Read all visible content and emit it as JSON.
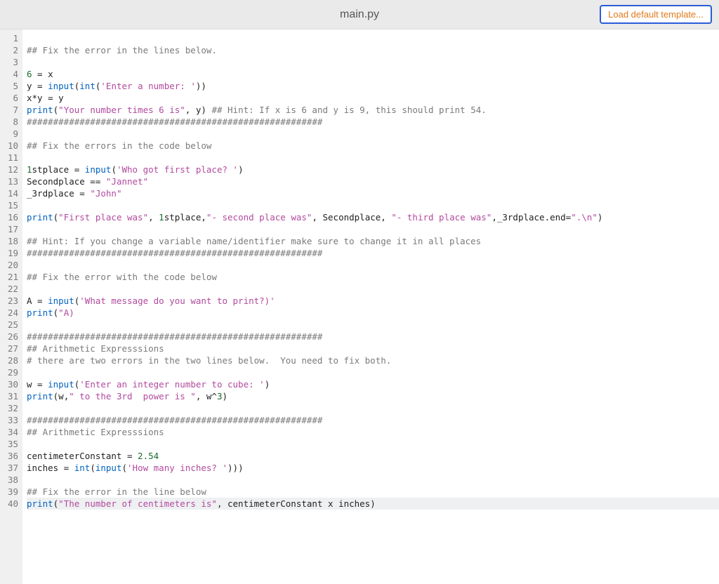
{
  "header": {
    "title": "main.py",
    "load_button": "Load default template..."
  },
  "editor": {
    "highlight_line": 40,
    "lines": [
      [],
      [
        {
          "t": "cm",
          "v": "## Fix the error in the lines below."
        }
      ],
      [],
      [
        {
          "t": "num",
          "v": "6"
        },
        {
          "t": "id",
          "v": " = x"
        }
      ],
      [
        {
          "t": "id",
          "v": "y = "
        },
        {
          "t": "fn",
          "v": "input"
        },
        {
          "t": "id",
          "v": "("
        },
        {
          "t": "fn",
          "v": "int"
        },
        {
          "t": "id",
          "v": "("
        },
        {
          "t": "str",
          "v": "'Enter a number: '"
        },
        {
          "t": "id",
          "v": "))"
        }
      ],
      [
        {
          "t": "id",
          "v": "x*y = y"
        }
      ],
      [
        {
          "t": "fn",
          "v": "print"
        },
        {
          "t": "id",
          "v": "("
        },
        {
          "t": "str",
          "v": "\"Your number times 6 is\""
        },
        {
          "t": "id",
          "v": ", y) "
        },
        {
          "t": "cm",
          "v": "## Hint: If x is 6 and y is 9, this should print 54."
        }
      ],
      [
        {
          "t": "cm",
          "v": "########################################################"
        }
      ],
      [],
      [
        {
          "t": "cm",
          "v": "## Fix the errors in the code below"
        }
      ],
      [],
      [
        {
          "t": "num",
          "v": "1"
        },
        {
          "t": "id",
          "v": "stplace = "
        },
        {
          "t": "fn",
          "v": "input"
        },
        {
          "t": "id",
          "v": "("
        },
        {
          "t": "str",
          "v": "'Who got first place? '"
        },
        {
          "t": "id",
          "v": ")"
        }
      ],
      [
        {
          "t": "id",
          "v": "Secondplace == "
        },
        {
          "t": "str",
          "v": "\"Jannet\""
        }
      ],
      [
        {
          "t": "id",
          "v": "_3rdplace = "
        },
        {
          "t": "str",
          "v": "\"John\""
        }
      ],
      [],
      [
        {
          "t": "fn",
          "v": "print"
        },
        {
          "t": "id",
          "v": "("
        },
        {
          "t": "str",
          "v": "\"First place was\""
        },
        {
          "t": "id",
          "v": ", "
        },
        {
          "t": "num",
          "v": "1"
        },
        {
          "t": "id",
          "v": "stplace,"
        },
        {
          "t": "str",
          "v": "\"- second place was\""
        },
        {
          "t": "id",
          "v": ", Secondplace, "
        },
        {
          "t": "str",
          "v": "\"- third place was\""
        },
        {
          "t": "id",
          "v": ",_3rdplace.end="
        },
        {
          "t": "str",
          "v": "\".\\n\""
        },
        {
          "t": "id",
          "v": ")"
        }
      ],
      [],
      [
        {
          "t": "cm",
          "v": "## Hint: If you change a variable name/identifier make sure to change it in all places"
        }
      ],
      [
        {
          "t": "cm",
          "v": "########################################################"
        }
      ],
      [],
      [
        {
          "t": "cm",
          "v": "## Fix the error with the code below"
        }
      ],
      [],
      [
        {
          "t": "id",
          "v": "A = "
        },
        {
          "t": "fn",
          "v": "input"
        },
        {
          "t": "id",
          "v": "("
        },
        {
          "t": "str",
          "v": "'What message do you want to print?)'"
        }
      ],
      [
        {
          "t": "fn",
          "v": "print"
        },
        {
          "t": "id",
          "v": "("
        },
        {
          "t": "str",
          "v": "\"A)"
        }
      ],
      [],
      [
        {
          "t": "cm",
          "v": "########################################################"
        }
      ],
      [
        {
          "t": "cm",
          "v": "## Arithmetic Expresssions"
        }
      ],
      [
        {
          "t": "cm",
          "v": "# there are two errors in the two lines below.  You need to fix both."
        }
      ],
      [],
      [
        {
          "t": "id",
          "v": "w = "
        },
        {
          "t": "fn",
          "v": "input"
        },
        {
          "t": "id",
          "v": "("
        },
        {
          "t": "str",
          "v": "'Enter an integer number to cube: '"
        },
        {
          "t": "id",
          "v": ")"
        }
      ],
      [
        {
          "t": "fn",
          "v": "print"
        },
        {
          "t": "id",
          "v": "(w,"
        },
        {
          "t": "str",
          "v": "\" to the 3rd  power is \""
        },
        {
          "t": "id",
          "v": ", w^"
        },
        {
          "t": "num",
          "v": "3"
        },
        {
          "t": "id",
          "v": ")"
        }
      ],
      [],
      [
        {
          "t": "cm",
          "v": "########################################################"
        }
      ],
      [
        {
          "t": "cm",
          "v": "## Arithmetic Expresssions"
        }
      ],
      [],
      [
        {
          "t": "id",
          "v": "centimeterConstant = "
        },
        {
          "t": "num",
          "v": "2.54"
        }
      ],
      [
        {
          "t": "id",
          "v": "inches = "
        },
        {
          "t": "fn",
          "v": "int"
        },
        {
          "t": "id",
          "v": "("
        },
        {
          "t": "fn",
          "v": "input"
        },
        {
          "t": "id",
          "v": "("
        },
        {
          "t": "str",
          "v": "'How many inches? '"
        },
        {
          "t": "id",
          "v": ")))"
        }
      ],
      [],
      [
        {
          "t": "cm",
          "v": "## Fix the error in the line below"
        }
      ],
      [
        {
          "t": "fn",
          "v": "print"
        },
        {
          "t": "id",
          "v": "("
        },
        {
          "t": "str",
          "v": "\"The number of centimeters is\""
        },
        {
          "t": "id",
          "v": ", centimeterConstant x inches)"
        }
      ]
    ]
  }
}
